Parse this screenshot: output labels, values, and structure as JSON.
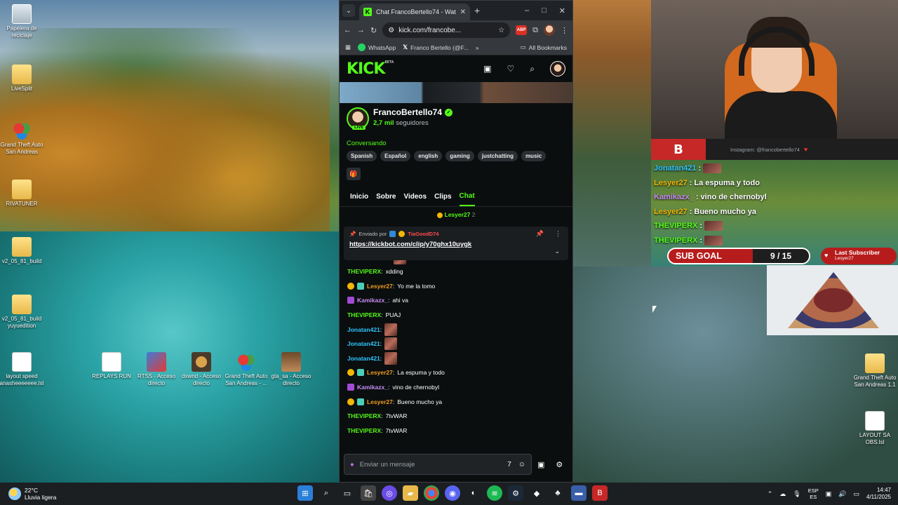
{
  "desktop": {
    "left_icons": [
      {
        "label": "Papelera de reciclaje",
        "icon": "recycle-bin-icon"
      },
      {
        "label": "LiveSplit",
        "icon": "folder-icon"
      },
      {
        "label": "Grand Theft Auto San Andreas",
        "icon": "gta-icon"
      },
      {
        "label": "RIVATUNER",
        "icon": "folder-icon"
      },
      {
        "label": "v2_05_81_build",
        "icon": "folder-icon"
      },
      {
        "label": "v2_05_81_build yuyuedition",
        "icon": "folder-icon"
      }
    ],
    "bottom_icons": [
      {
        "label": "layout speed anasheeeeeee.lsl",
        "icon": "file-icon"
      },
      {
        "label": "REPLAYS RUN",
        "icon": "file-icon"
      },
      {
        "label": "RTSS - Acceso directo",
        "icon": "rtss-icon"
      },
      {
        "label": "dxwnd - Acceso directo",
        "icon": "dxwnd-icon"
      },
      {
        "label": "Grand Theft Auto San Andreas - ...",
        "icon": "gta-icon"
      },
      {
        "label": "gta_sa - Acceso directo",
        "icon": "shortcut-icon"
      }
    ],
    "right_icons": [
      {
        "label": "Grand Theft Auto San Andreas 1.1",
        "icon": "folder-icon"
      },
      {
        "label": "LAYOUT SA OBS.lsl",
        "icon": "file-icon"
      }
    ]
  },
  "browser": {
    "tab_title": "Chat FrancoBertello74 - Watch",
    "tab_favicon": "K",
    "url": "kick.com/francobe...",
    "abp_label": "ABP",
    "bookmarks": [
      "WhatsApp",
      "Franco Bertello (@F...",
      "All Bookmarks"
    ],
    "window_controls": [
      "–",
      "□",
      "✕"
    ]
  },
  "kick": {
    "logo": "KICK",
    "logo_beta": "BETA",
    "channel_name": "FrancoBertello74",
    "live_label": "LIVE",
    "followers_count": "2,7 mil",
    "followers_label": "seguidores",
    "category": "Conversando",
    "tags": [
      "Spanish",
      "Español",
      "english",
      "gaming",
      "justchatting",
      "music"
    ],
    "tabs": [
      "Inicio",
      "Sobre",
      "Videos",
      "Clips",
      "Chat"
    ],
    "active_tab": "Chat",
    "pinned_top_user": "Lesyer27",
    "pinned_top_count": "2",
    "pinned": {
      "sent_by": "Enviado por",
      "user": "TiaGoodD74",
      "link": "https://kickbot.com/clip/y70ghx10uygk"
    },
    "messages": [
      {
        "user": "THEVIPERX",
        "color": "#53fc18",
        "text": "xdding",
        "badges": []
      },
      {
        "user": "Lesyer27",
        "color": "#f29d1c",
        "text": "Yo me la tomo",
        "badges": [
          "y",
          "s"
        ]
      },
      {
        "user": "Kamikazx_",
        "color": "#c58cf5",
        "text": "ahi va",
        "badges": [
          "p"
        ]
      },
      {
        "user": "THEVIPERX",
        "color": "#53fc18",
        "text": "PUAJ",
        "badges": []
      },
      {
        "user": "Jonatan421",
        "color": "#2ec4ff",
        "text": "",
        "emote": true,
        "badges": []
      },
      {
        "user": "Jonatan421",
        "color": "#2ec4ff",
        "text": "",
        "emote": true,
        "badges": []
      },
      {
        "user": "Jonatan421",
        "color": "#2ec4ff",
        "text": "",
        "emote": true,
        "badges": []
      },
      {
        "user": "Lesyer27",
        "color": "#f29d1c",
        "text": "La espuma y todo",
        "badges": [
          "y",
          "s"
        ]
      },
      {
        "user": "Kamikazx_",
        "color": "#c58cf5",
        "text": "vino de chernobyl",
        "badges": [
          "p"
        ]
      },
      {
        "user": "Lesyer27",
        "color": "#f29d1c",
        "text": "Bueno mucho ya",
        "badges": [
          "y",
          "s"
        ]
      },
      {
        "user": "THEVIPERX",
        "color": "#53fc18",
        "text": "7tvWAR",
        "badges": []
      },
      {
        "user": "THEVIPERX",
        "color": "#53fc18",
        "text": "7tvWAR",
        "badges": []
      }
    ],
    "input_placeholder": "Enviar un mensaje"
  },
  "overlay": {
    "instagram": "Instagram: @francobertello74",
    "chat": [
      {
        "user": "Jonatan421",
        "color": "#2ec4ff",
        "text": "",
        "emote": true
      },
      {
        "user": "Lesyer27",
        "color": "#f2b705",
        "text": "La espuma y todo"
      },
      {
        "user": "Kamikazx_",
        "color": "#c58cf5",
        "text": "vino de chernobyl"
      },
      {
        "user": "Lesyer27",
        "color": "#f2b705",
        "text": "Bueno mucho ya"
      },
      {
        "user": "THEVIPERX",
        "color": "#53fc18",
        "text": "",
        "emote": true
      },
      {
        "user": "THEVIPERX",
        "color": "#53fc18",
        "text": "",
        "emote": true
      }
    ],
    "sub_goal_label": "SUB GOAL",
    "sub_goal_value": "9 / 15",
    "last_sub_title": "Last Subscriber",
    "last_sub_name": "Lesyer27"
  },
  "taskbar": {
    "temp": "22°C",
    "weather": "Lluvia ligera",
    "lang_top": "ESP",
    "lang_bottom": "ES",
    "time": "14:47",
    "date": "4/11/2025"
  }
}
